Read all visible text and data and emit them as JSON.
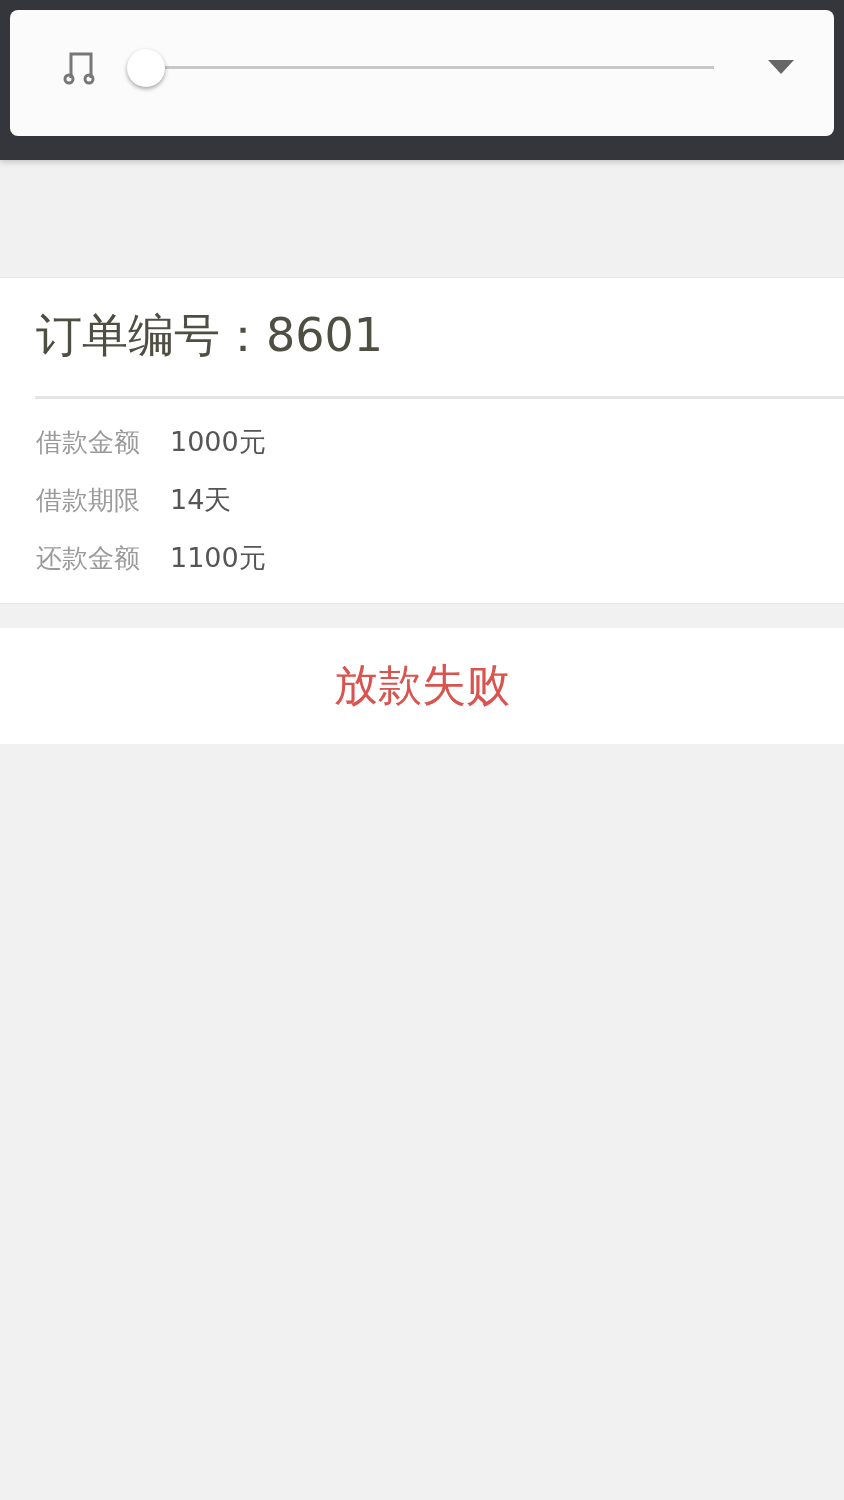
{
  "player": {
    "level": 0
  },
  "order": {
    "title": "订单编号：8601",
    "details": [
      {
        "label": "借款金额",
        "value": "1000元"
      },
      {
        "label": "借款期限",
        "value": "14天"
      },
      {
        "label": "还款金额",
        "value": "1100元"
      }
    ]
  },
  "status": {
    "text": "放款失败"
  }
}
